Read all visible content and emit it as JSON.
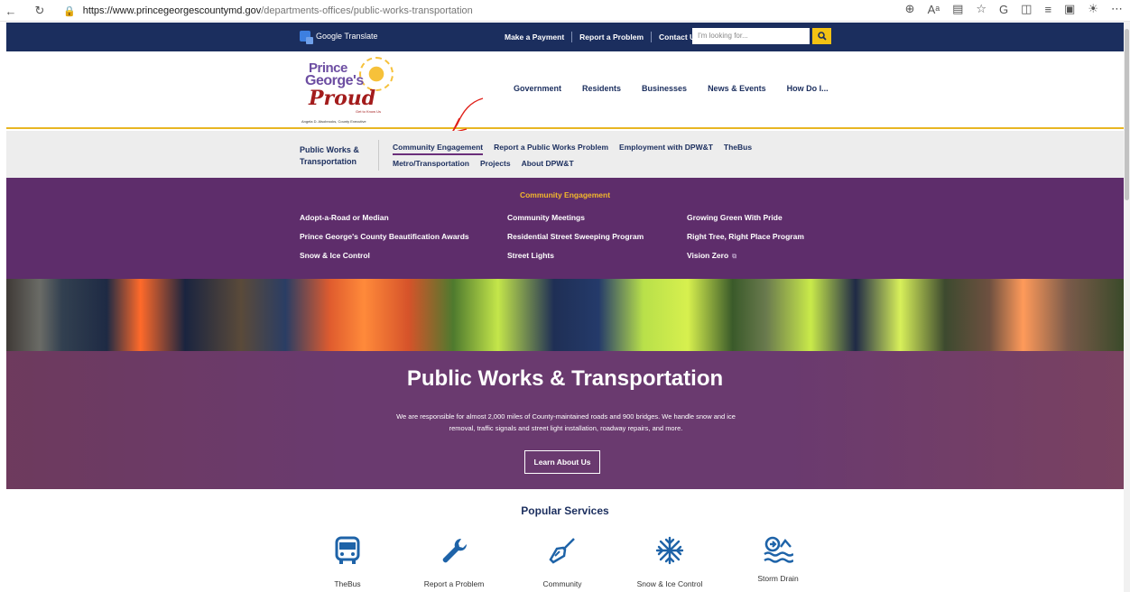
{
  "browser": {
    "url_host": "https://www.princegeorgescountymd.gov",
    "url_path": "/departments-offices/public-works-transportation"
  },
  "utility": {
    "google_translate": "Google Translate",
    "links": [
      "Make a Payment",
      "Report a Problem",
      "Contact Us"
    ],
    "search_placeholder": "I'm looking for..."
  },
  "logo": {
    "line1": "Prince",
    "line2": "George's",
    "line3": "Proud",
    "tagline": "Get to Know Us",
    "executive": "Angela D. Alsobrooks, County Executive"
  },
  "main_nav": [
    "Government",
    "Residents",
    "Businesses",
    "News & Events",
    "How Do I..."
  ],
  "subnav": {
    "section": "Public Works & Transportation",
    "row1": [
      "Community Engagement",
      "Report a Public Works Problem",
      "Employment with DPW&T",
      "TheBus"
    ],
    "row2": [
      "Metro/Transportation",
      "Projects",
      "About DPW&T"
    ]
  },
  "mega": {
    "title": "Community Engagement",
    "col1": [
      "Adopt-a-Road or Median",
      "Prince George's County Beautification Awards",
      "Snow & Ice Control"
    ],
    "col2": [
      "Community Meetings",
      "Residential Street Sweeping Program",
      "Street Lights"
    ],
    "col3": [
      "Growing Green With Pride",
      "Right Tree, Right Place Program",
      "Vision Zero"
    ]
  },
  "hero": {
    "title": "Public Works & Transportation",
    "text": "We are responsible for almost 2,000 miles of County-maintained roads and 900 bridges. We handle snow and ice removal, traffic signals and street light installation, roadway repairs, and more.",
    "button": "Learn About Us"
  },
  "popular": {
    "title": "Popular Services",
    "items": [
      {
        "label": "TheBus",
        "icon": "bus-icon"
      },
      {
        "label": "Report a Problem",
        "icon": "wrench-icon"
      },
      {
        "label": "Community",
        "icon": "broom-icon"
      },
      {
        "label": "Snow & Ice Control",
        "icon": "snowflake-icon"
      },
      {
        "label": "Storm Drain",
        "icon": "storm-drain-icon"
      }
    ]
  },
  "colors": {
    "navy": "#1b2e5e",
    "purple": "#5e2d6b",
    "gold": "#f3b82b",
    "service_blue": "#1e63a8"
  }
}
